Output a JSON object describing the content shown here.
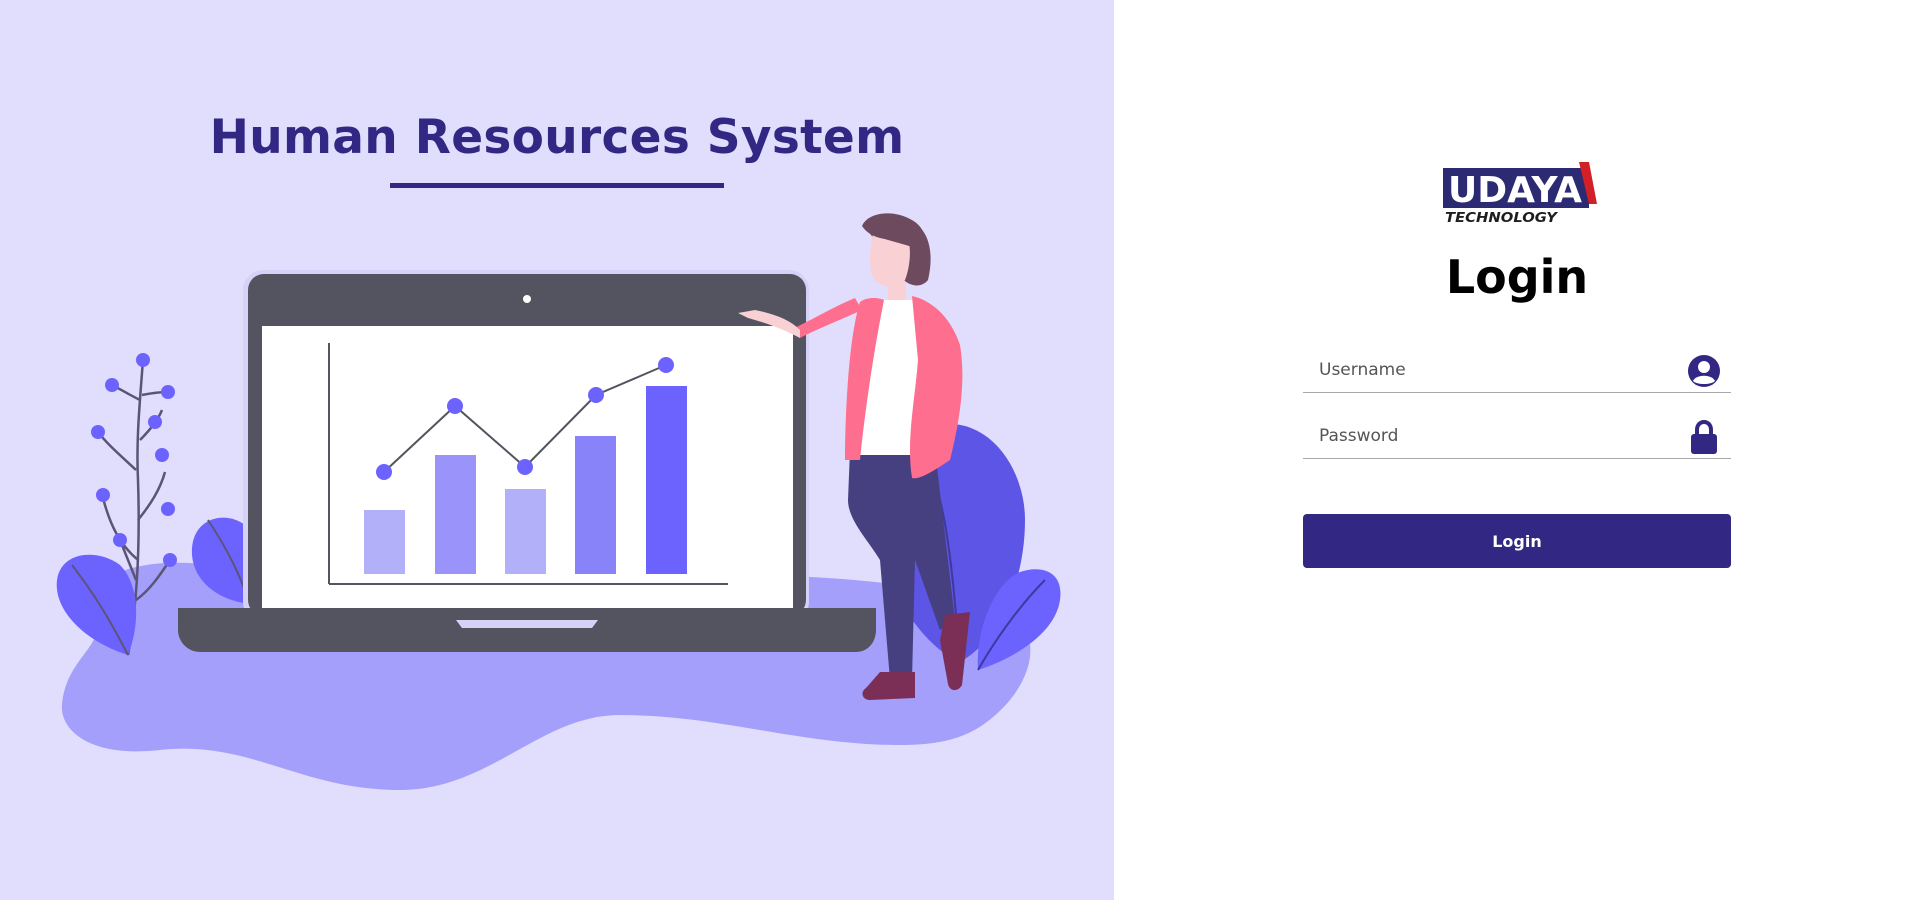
{
  "hero": {
    "title": "Human Resources System"
  },
  "brand": {
    "name": "UDAYA",
    "tagline": "TECHNOLOGY"
  },
  "login": {
    "heading": "Login",
    "username_placeholder": "Username",
    "password_placeholder": "Password",
    "submit_label": "Login"
  },
  "icons": {
    "username": "user-circle-icon",
    "password": "lock-icon"
  },
  "colors": {
    "primary": "#322783",
    "hero_background": "#e1ddfc",
    "accent": "#6c63ff",
    "brand_red": "#d31f26"
  }
}
